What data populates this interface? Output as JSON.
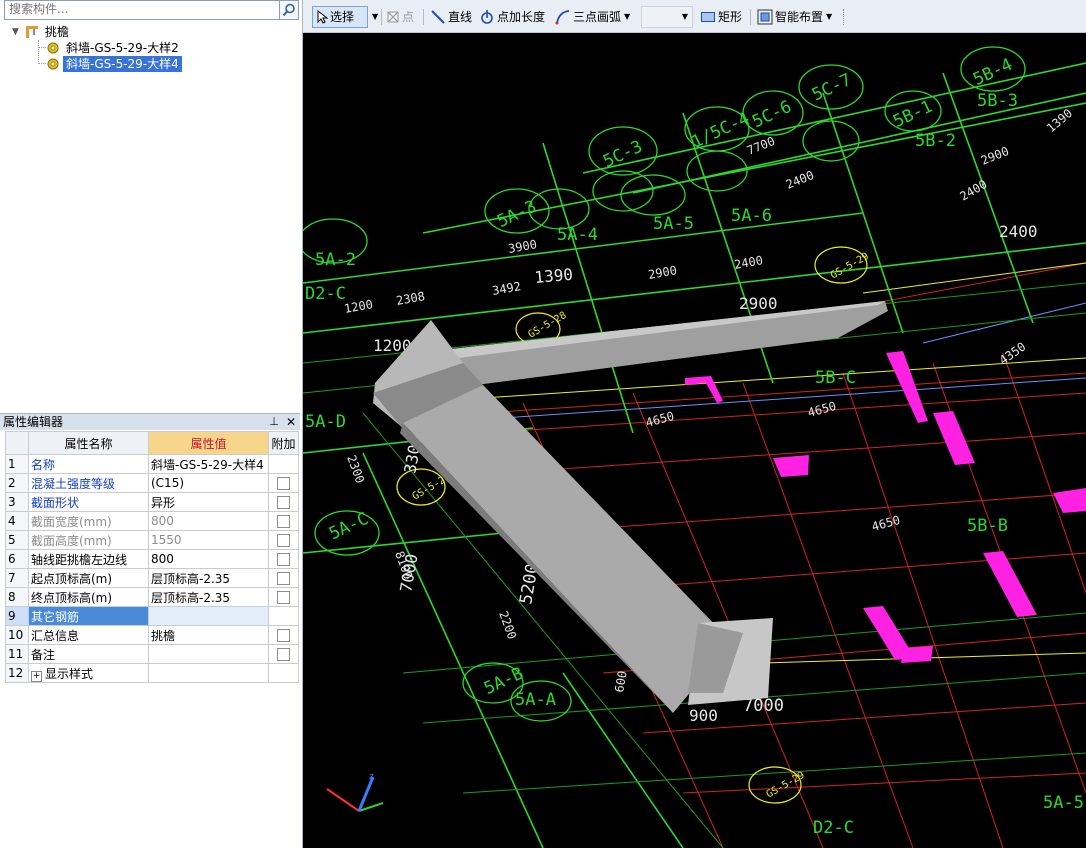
{
  "search": {
    "placeholder": "搜索构件..."
  },
  "tree": {
    "root": "挑檐",
    "items": [
      "斜墙-GS-5-29-大样2",
      "斜墙-GS-5-29-大样4"
    ]
  },
  "property_editor": {
    "title": "属性编辑器",
    "columns": [
      "属性名称",
      "属性值",
      "附加"
    ],
    "rows": [
      {
        "no": "1",
        "name": "名称",
        "value": "斜墙-GS-5-29-大样4",
        "style": "blue"
      },
      {
        "no": "2",
        "name": "混凝土强度等级",
        "value": "(C15)",
        "style": "blue"
      },
      {
        "no": "3",
        "name": "截面形状",
        "value": "异形",
        "style": "blue"
      },
      {
        "no": "4",
        "name": "截面宽度(mm)",
        "value": "800",
        "style": "gray"
      },
      {
        "no": "5",
        "name": "截面高度(mm)",
        "value": "1550",
        "style": "gray"
      },
      {
        "no": "6",
        "name": "轴线距挑檐左边线",
        "value": "800",
        "style": "normal"
      },
      {
        "no": "7",
        "name": "起点顶标高(m)",
        "value": "层顶标高-2.35",
        "style": "normal"
      },
      {
        "no": "8",
        "name": "终点顶标高(m)",
        "value": "层顶标高-2.35",
        "style": "normal"
      },
      {
        "no": "9",
        "name": "其它钢筋",
        "value": "",
        "style": "selected"
      },
      {
        "no": "10",
        "name": "汇总信息",
        "value": "挑檐",
        "style": "normal"
      },
      {
        "no": "11",
        "name": "备注",
        "value": "",
        "style": "normal"
      },
      {
        "no": "12",
        "name": "显示样式",
        "value": "",
        "style": "expand"
      }
    ]
  },
  "toolbar": {
    "select": "选择",
    "point": "点",
    "line": "直线",
    "point_length": "点加长度",
    "arc3": "三点画弧",
    "rect": "矩形",
    "smart": "智能布置"
  },
  "viewport_labels": {
    "axes": [
      "5C-3",
      "1/5C-4",
      "5C-6",
      "5C-7",
      "5B-1",
      "5B-2",
      "5B-3",
      "5B-4",
      "5A-3",
      "5A-4",
      "5A-5",
      "5A-6",
      "5A-2",
      "D2-C",
      "5B-C",
      "5A-D",
      "5A-C",
      "5B-B",
      "5A-B",
      "5A-A",
      "D2-C",
      "5A-5"
    ],
    "dims": [
      "7700",
      "2400",
      "2900",
      "1390",
      "3900",
      "2400",
      "2308",
      "3492",
      "2900",
      "2400",
      "1200",
      "1200",
      "2900",
      "4650",
      "4650",
      "4650",
      "4350",
      "3300",
      "2300",
      "7000",
      "5200",
      "2200",
      "7000",
      "900",
      "600",
      "8100",
      "2400",
      "1390"
    ],
    "tags": [
      "GS-5-29",
      "GS-5-28",
      "GS-5-29",
      "GS-5-28"
    ]
  },
  "colors": {
    "viewport_bg": "#000000",
    "axis_green": "#2cd92c",
    "grid_red": "#d22323",
    "magenta": "#ff22e3",
    "beam_gray": "#a9a9a9",
    "yellow": "#f0f020"
  }
}
